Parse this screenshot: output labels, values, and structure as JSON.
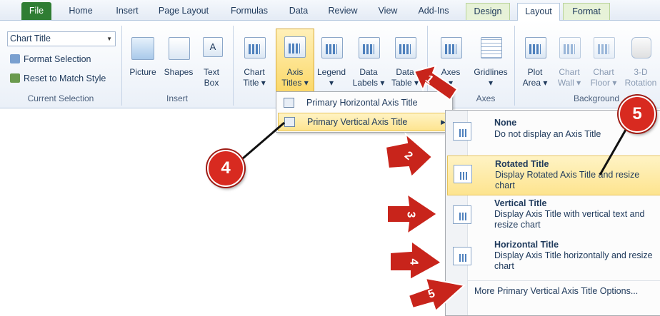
{
  "tabs": {
    "file": "File",
    "home": "Home",
    "insert": "Insert",
    "page_layout": "Page Layout",
    "formulas": "Formulas",
    "data": "Data",
    "review": "Review",
    "view": "View",
    "addins": "Add-Ins",
    "design": "Design",
    "layout": "Layout",
    "format": "Format"
  },
  "current_selection": {
    "combo_value": "Chart Title",
    "format_selection": "Format Selection",
    "reset_style": "Reset to Match Style",
    "group_label": "Current Selection"
  },
  "insert_group": {
    "picture": "Picture",
    "shapes": "Shapes",
    "text_box_1": "Text",
    "text_box_2": "Box",
    "group_label": "Insert"
  },
  "labels_group": {
    "chart_title_1": "Chart",
    "chart_title_2": "Title ▾",
    "axis_titles_1": "Axis",
    "axis_titles_2": "Titles ▾",
    "legend_1": "Legend",
    "legend_2": "▾",
    "data_labels_1": "Data",
    "data_labels_2": "Labels ▾",
    "data_table_1": "Data",
    "data_table_2": "Table ▾"
  },
  "axes_group": {
    "axes_1": "Axes",
    "axes_2": "▾",
    "gridlines_1": "Gridlines",
    "gridlines_2": "▾",
    "group_label": "Axes"
  },
  "background_group": {
    "plot_area_1": "Plot",
    "plot_area_2": "Area ▾",
    "chart_wall_1": "Chart",
    "chart_wall_2": "Wall ▾",
    "chart_floor_1": "Chart",
    "chart_floor_2": "Floor ▾",
    "rotation_1": "3-D",
    "rotation_2": "Rotation",
    "group_label": "Background"
  },
  "axis_menu": {
    "horizontal": "Primary Horizontal Axis Title",
    "vertical": "Primary Vertical Axis Title"
  },
  "vertical_submenu": {
    "none_title": "None",
    "none_desc": "Do not display an Axis Title",
    "rotated_title": "Rotated Title",
    "rotated_desc": "Display Rotated Axis Title and resize chart",
    "vertical_title": "Vertical Title",
    "vertical_desc": "Display Axis Title with vertical text and resize chart",
    "horizontal_title": "Horizontal Title",
    "horizontal_desc": "Display Axis Title horizontally and resize chart",
    "more_options": "More Primary Vertical Axis Title Options..."
  },
  "callouts": {
    "badge_left": "4",
    "badge_right": "5",
    "arrow_1": "1",
    "arrow_2": "2",
    "arrow_3": "3",
    "arrow_4": "4",
    "arrow_5": "5"
  },
  "colors": {
    "file_tab": "#2f7d33",
    "highlight": "#fde48f",
    "callout_red": "#d82a20"
  }
}
